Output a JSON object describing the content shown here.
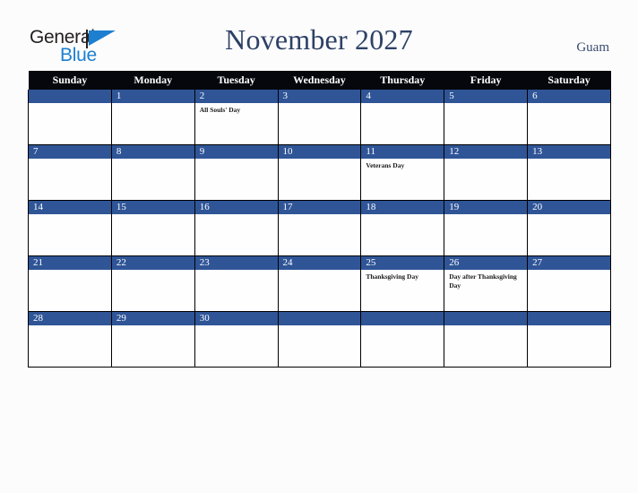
{
  "brand": {
    "name_part1": "General",
    "name_part2": "Blue",
    "flag_icon": "blue-triangle-flag-icon",
    "accent_color": "#1c7fd0"
  },
  "header": {
    "title": "November 2027",
    "region": "Guam"
  },
  "colors": {
    "header_row_bg": "#06070c",
    "date_band_bg": "#2f5597",
    "title_text": "#2d4165",
    "page_bg": "#fcfcfd",
    "cell_bg": "#fefeff",
    "grid_line": "#000000"
  },
  "calendar": {
    "month": "November",
    "year": "2027",
    "weekday_headers": [
      "Sunday",
      "Monday",
      "Tuesday",
      "Wednesday",
      "Thursday",
      "Friday",
      "Saturday"
    ],
    "weeks": [
      [
        {
          "day": "",
          "events": []
        },
        {
          "day": "1",
          "events": []
        },
        {
          "day": "2",
          "events": [
            "All Souls' Day"
          ]
        },
        {
          "day": "3",
          "events": []
        },
        {
          "day": "4",
          "events": []
        },
        {
          "day": "5",
          "events": []
        },
        {
          "day": "6",
          "events": []
        }
      ],
      [
        {
          "day": "7",
          "events": []
        },
        {
          "day": "8",
          "events": []
        },
        {
          "day": "9",
          "events": []
        },
        {
          "day": "10",
          "events": []
        },
        {
          "day": "11",
          "events": [
            "Veterans Day"
          ]
        },
        {
          "day": "12",
          "events": []
        },
        {
          "day": "13",
          "events": []
        }
      ],
      [
        {
          "day": "14",
          "events": []
        },
        {
          "day": "15",
          "events": []
        },
        {
          "day": "16",
          "events": []
        },
        {
          "day": "17",
          "events": []
        },
        {
          "day": "18",
          "events": []
        },
        {
          "day": "19",
          "events": []
        },
        {
          "day": "20",
          "events": []
        }
      ],
      [
        {
          "day": "21",
          "events": []
        },
        {
          "day": "22",
          "events": []
        },
        {
          "day": "23",
          "events": []
        },
        {
          "day": "24",
          "events": []
        },
        {
          "day": "25",
          "events": [
            "Thanksgiving Day"
          ]
        },
        {
          "day": "26",
          "events": [
            "Day after Thanksgiving Day"
          ]
        },
        {
          "day": "27",
          "events": []
        }
      ],
      [
        {
          "day": "28",
          "events": []
        },
        {
          "day": "29",
          "events": []
        },
        {
          "day": "30",
          "events": []
        },
        {
          "day": "",
          "events": []
        },
        {
          "day": "",
          "events": []
        },
        {
          "day": "",
          "events": []
        },
        {
          "day": "",
          "events": []
        }
      ]
    ]
  }
}
